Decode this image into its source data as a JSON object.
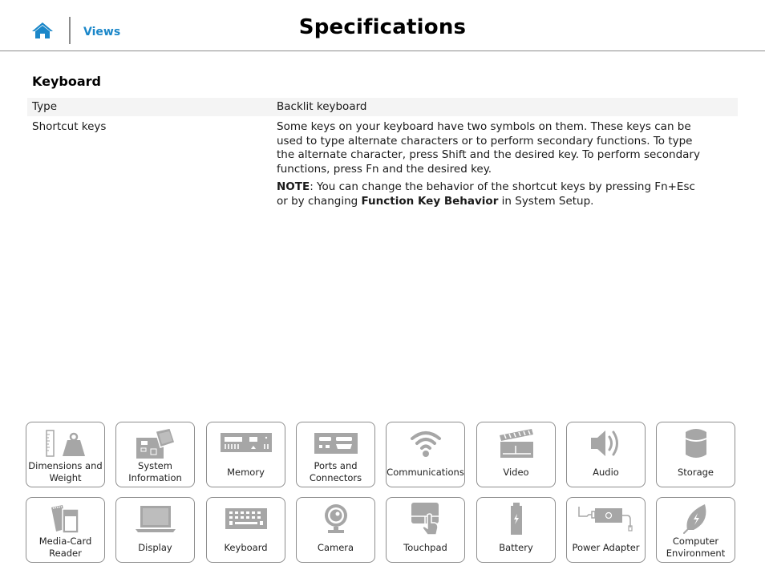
{
  "header": {
    "home_icon": "home-icon",
    "views_link": "Views",
    "title": "Specifications"
  },
  "colors": {
    "accent": "#1b87c9",
    "icon_gray": "#a6a6a6",
    "divider": "#8c8c8c",
    "row_shade": "#f4f4f4"
  },
  "section": {
    "title": "Keyboard",
    "rows": [
      {
        "label": "Type",
        "value": "Backlit keyboard"
      },
      {
        "label": "Shortcut keys",
        "value": "Some keys on your keyboard have two symbols on them. These keys can be used to type alternate characters or to perform secondary functions. To type the alternate character, press Shift and the desired key. To perform secondary functions, press Fn and the desired key.",
        "note_label": "NOTE",
        "note_text_1": ": You can change the behavior of the shortcut keys by pressing Fn+Esc or by changing ",
        "note_bold": "Function Key Behavior",
        "note_text_2": " in System Setup."
      }
    ]
  },
  "nav_tiles": [
    {
      "label": "Dimensions and Weight",
      "icon": "dimensions-weight-icon"
    },
    {
      "label": "System Information",
      "icon": "system-board-icon"
    },
    {
      "label": "Memory",
      "icon": "memory-module-icon"
    },
    {
      "label": "Ports and Connectors",
      "icon": "ports-icon"
    },
    {
      "label": "Communications",
      "icon": "wifi-icon"
    },
    {
      "label": "Video",
      "icon": "clapperboard-icon"
    },
    {
      "label": "Audio",
      "icon": "speaker-icon"
    },
    {
      "label": "Storage",
      "icon": "storage-cylinder-icon"
    },
    {
      "label": "Media-Card Reader",
      "icon": "sd-card-icon"
    },
    {
      "label": "Display",
      "icon": "laptop-display-icon"
    },
    {
      "label": "Keyboard",
      "icon": "keyboard-icon"
    },
    {
      "label": "Camera",
      "icon": "webcam-icon"
    },
    {
      "label": "Touchpad",
      "icon": "touchpad-icon"
    },
    {
      "label": "Battery",
      "icon": "battery-icon"
    },
    {
      "label": "Power Adapter",
      "icon": "power-adapter-icon"
    },
    {
      "label": "Computer Environment",
      "icon": "leaf-icon"
    }
  ]
}
